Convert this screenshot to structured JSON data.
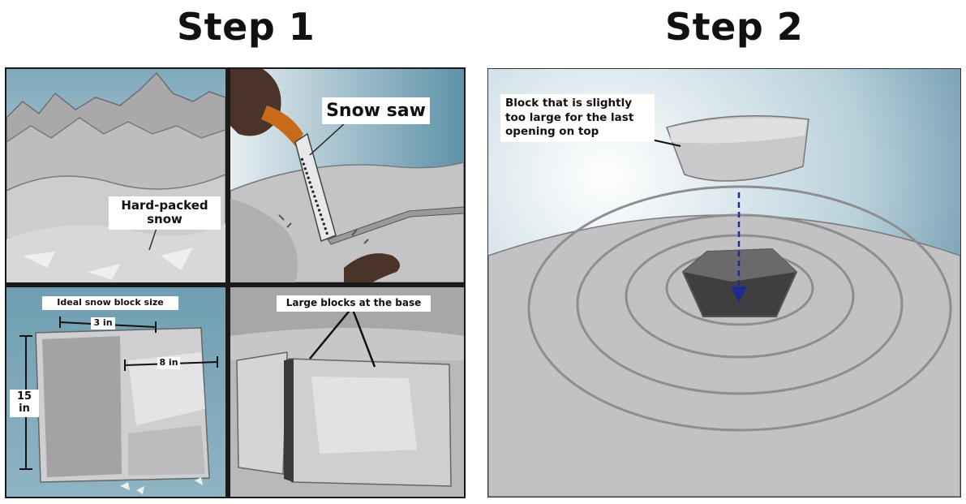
{
  "titles": {
    "step1": "Step 1",
    "step2": "Step 2"
  },
  "step1": {
    "mountains_panel": {
      "label": "Hard-packed snow"
    },
    "saw_panel": {
      "label": "Snow saw"
    },
    "block_panel": {
      "title": "Ideal snow block size",
      "width_label": "3 in",
      "depth_label": "8 in",
      "height_label": "15 in"
    },
    "base_panel": {
      "label": "Large blocks at the base"
    }
  },
  "step2": {
    "label": "Block that is slightly too large for the last opening on top"
  },
  "colors": {
    "sky": "#6f9eb2",
    "snow": "#c9c9c9",
    "shadow": "#8c8c8c",
    "arrow": "#1d2a8f"
  }
}
